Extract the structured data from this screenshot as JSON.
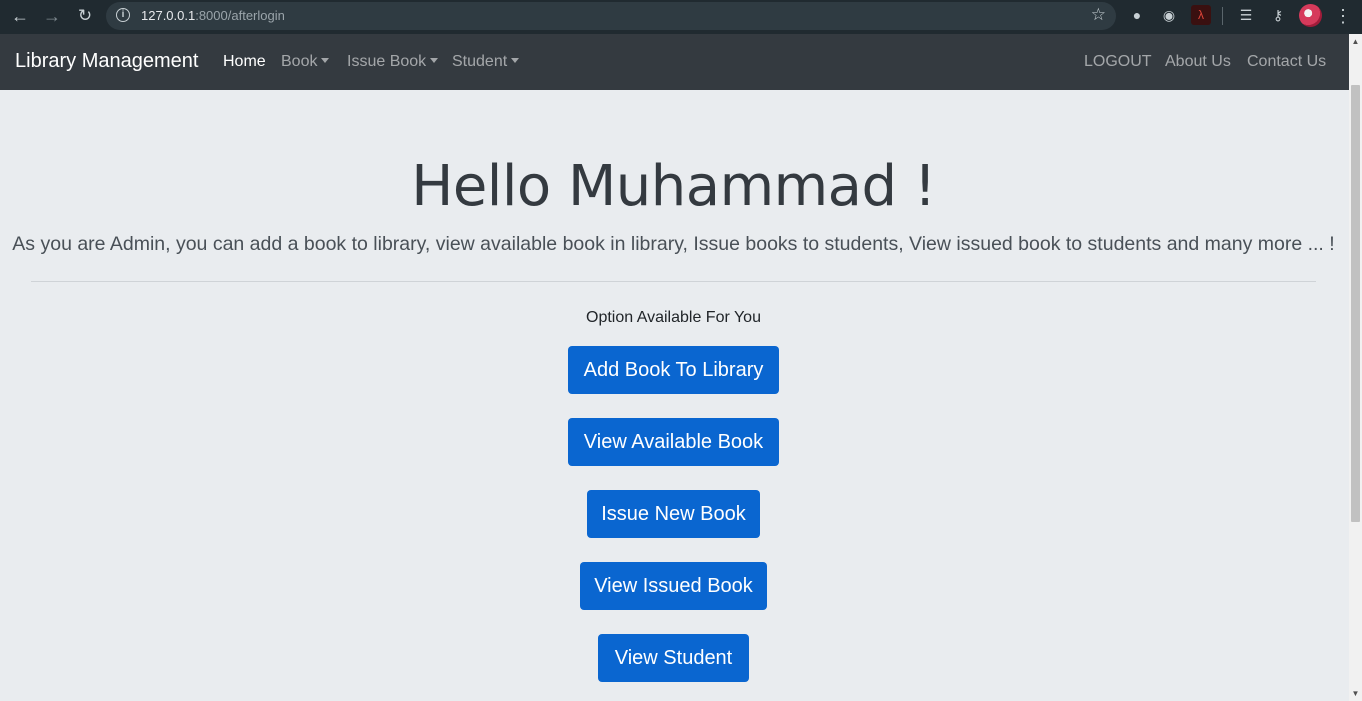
{
  "browser": {
    "url_host": "127.0.0.1",
    "url_path": ":8000/afterlogin"
  },
  "navbar": {
    "brand": "Library Management",
    "items": [
      {
        "label": "Home",
        "active": true,
        "dropdown": false
      },
      {
        "label": "Book",
        "active": false,
        "dropdown": true
      },
      {
        "label": "Issue Book",
        "active": false,
        "dropdown": true
      },
      {
        "label": "Student",
        "active": false,
        "dropdown": true
      }
    ],
    "right_items": [
      {
        "label": "LOGOUT"
      },
      {
        "label": "About Us"
      },
      {
        "label": "Contact Us"
      }
    ]
  },
  "main": {
    "greeting": "Hello Muhammad !",
    "lead": "As you are Admin, you can add a book to library, view available book in library, Issue books to students, View issued book to students and many more ... !",
    "options_label": "Option Available For You",
    "buttons": [
      {
        "label": "Add Book To Library"
      },
      {
        "label": "View Available Book"
      },
      {
        "label": "Issue New Book"
      },
      {
        "label": "View Issued Book"
      },
      {
        "label": "View Student"
      }
    ]
  },
  "colors": {
    "navbar_bg": "#343a40",
    "page_bg": "#e9ecef",
    "button_primary": "#0a66d0"
  }
}
